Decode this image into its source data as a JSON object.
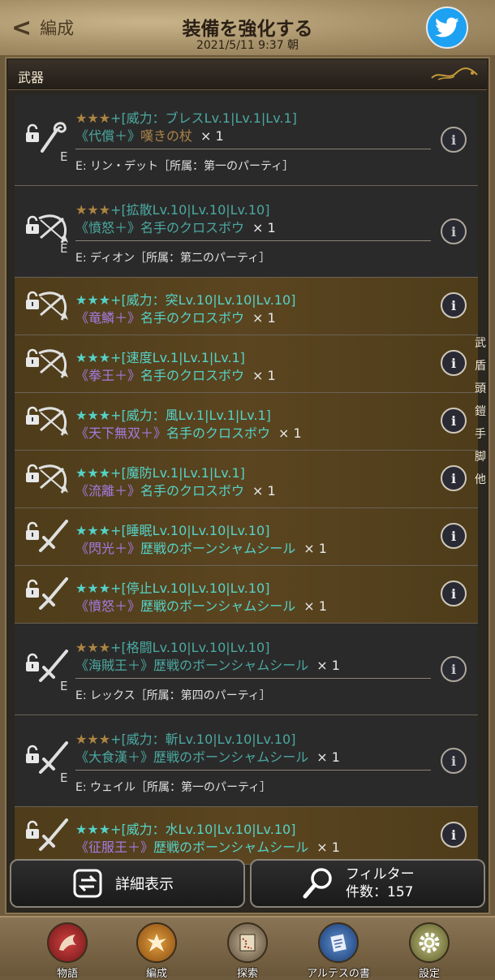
{
  "header": {
    "back_label": "編成",
    "title": "装備を強化する",
    "datetime": "2021/5/11  9:37 朝"
  },
  "section": {
    "label": "武器"
  },
  "items": [
    {
      "stars": "★★★",
      "attr": "+[威力：ブレスLv.1|Lv.1|Lv.1]",
      "enh": "《代償＋》",
      "name": "嘆きの杖",
      "count": "× 1",
      "equipped": "E",
      "owner": "E:  リン・デット［所属：第一のパーティ］",
      "weapon": "staff-icon"
    },
    {
      "stars": "★★★",
      "attr": "+[拡散Lv.10|Lv.10|Lv.10]",
      "enh": "《憤怒＋》",
      "name": "名手のクロスボウ",
      "count": "× 1",
      "equipped": "E",
      "owner": "E:  ディオン［所属：第二のパーティ］",
      "weapon": "crossbow-icon"
    },
    {
      "stars": "★★★",
      "attr": "+[威力：突Lv.10|Lv.10|Lv.10]",
      "enh": "《竜鱗＋》",
      "name": "名手のクロスボウ",
      "count": "× 1",
      "weapon": "crossbow-icon"
    },
    {
      "stars": "★★★",
      "attr": "+[速度Lv.1|Lv.1|Lv.1]",
      "enh": "《拳王＋》",
      "name": "名手のクロスボウ",
      "count": "× 1",
      "weapon": "crossbow-icon"
    },
    {
      "stars": "★★★",
      "attr": "+[威力：風Lv.1|Lv.1|Lv.1]",
      "enh": "《天下無双＋》",
      "name": "名手のクロスボウ",
      "count": "× 1",
      "weapon": "crossbow-icon"
    },
    {
      "stars": "★★★",
      "attr": "+[魔防Lv.1|Lv.1|Lv.1]",
      "enh": "《流離＋》",
      "name": "名手のクロスボウ",
      "count": "× 1",
      "weapon": "crossbow-icon"
    },
    {
      "stars": "★★★",
      "attr": "+[睡眠Lv.10|Lv.10|Lv.10]",
      "enh": "《閃光＋》",
      "name": "歴戦のボーンシャムシール",
      "count": "× 1",
      "weapon": "sword-icon"
    },
    {
      "stars": "★★★",
      "attr": "+[停止Lv.10|Lv.10|Lv.10]",
      "enh": "《憤怒＋》",
      "name": "歴戦のボーンシャムシール",
      "count": "× 1",
      "weapon": "sword-icon"
    },
    {
      "stars": "★★★",
      "attr": "+[格闘Lv.10|Lv.10|Lv.10]",
      "enh": "《海賊王＋》",
      "name": "歴戦のボーンシャムシール",
      "count": "× 1",
      "equipped": "E",
      "owner": "E:  レックス［所属：第四のパーティ］",
      "weapon": "sword-icon"
    },
    {
      "stars": "★★★",
      "attr": "+[威力：斬Lv.10|Lv.10|Lv.10]",
      "enh": "《大食漢＋》",
      "name": "歴戦のボーンシャムシール",
      "count": "× 1",
      "equipped": "E",
      "owner": "E:  ウェイル［所属：第一のパーティ］",
      "weapon": "sword-icon"
    },
    {
      "stars": "★★★",
      "attr": "+[威力：水Lv.10|Lv.10|Lv.10]",
      "enh": "《征服王＋》",
      "name": "歴戦のボーンシャムシール",
      "count": "× 1",
      "weapon": "sword-icon"
    }
  ],
  "side_categories": [
    "武",
    "盾",
    "頭",
    "鎧",
    "手",
    "脚",
    "他"
  ],
  "buttons": {
    "detail_label": "詳細表示",
    "filter_label": "フィルター",
    "filter_count": "件数：157"
  },
  "nav": [
    "物語",
    "編成",
    "探索",
    "アルテスの書",
    "設定"
  ],
  "colors": {
    "accent_teal": "#55d2c8",
    "enhance_purple": "#a57ae0",
    "gold": "#d8a44a",
    "twitter": "#1da1f2"
  }
}
